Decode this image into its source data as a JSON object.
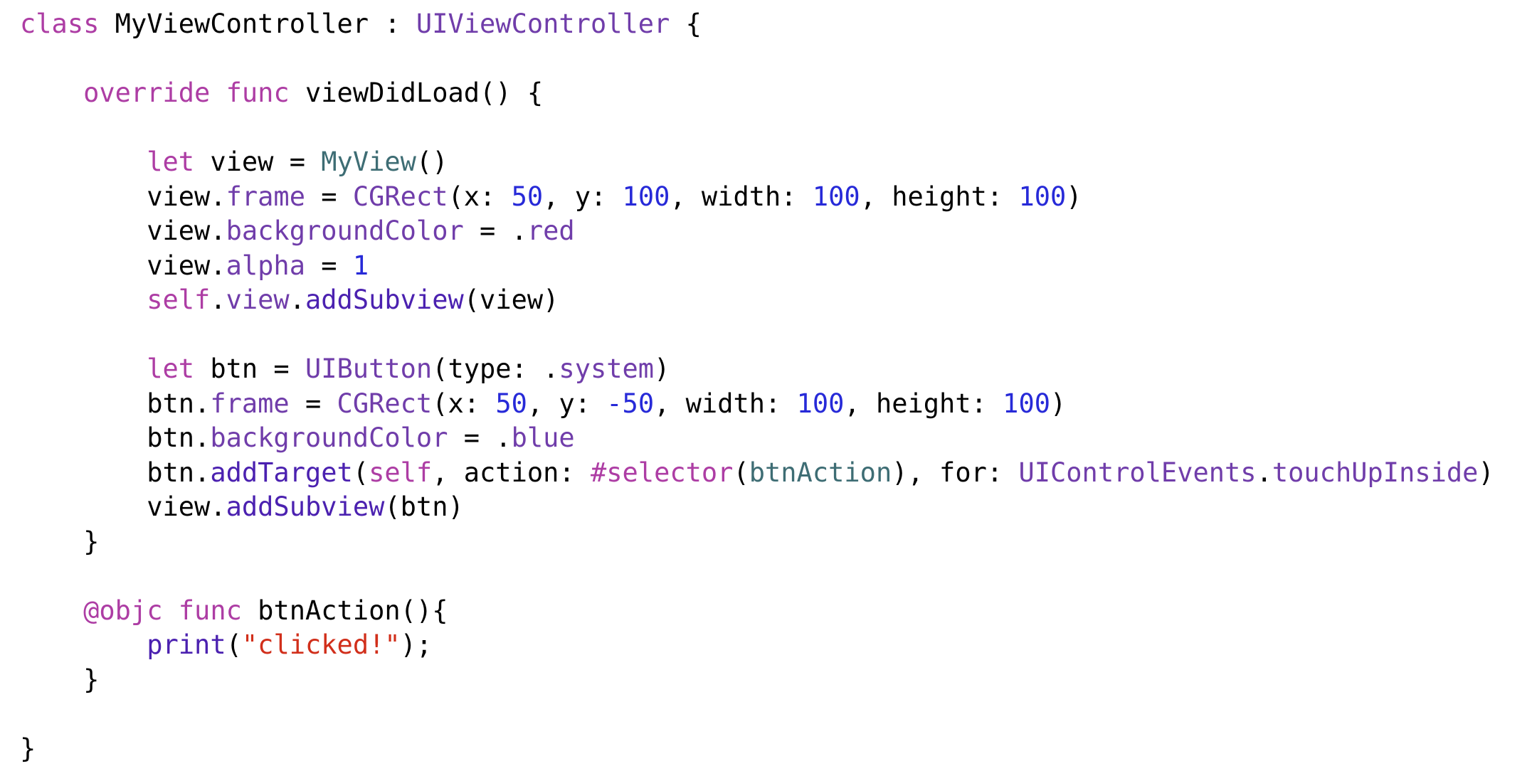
{
  "colors": {
    "plain": "#000000",
    "keyword": "#ad3da4",
    "type": "#703daa",
    "project_type": "#3e6d74",
    "project_name": "#4b21b0",
    "number": "#272ad8",
    "string": "#d12f1b"
  },
  "code": {
    "language": "Swift",
    "lines": [
      {
        "indent": "",
        "tokens": [
          [
            "keyword",
            "class"
          ],
          [
            "plain",
            " MyViewController : "
          ],
          [
            "type",
            "UIViewController"
          ],
          [
            "plain",
            " {"
          ]
        ]
      },
      {
        "indent": "",
        "tokens": []
      },
      {
        "indent": "    ",
        "tokens": [
          [
            "keyword",
            "override"
          ],
          [
            "plain",
            " "
          ],
          [
            "keyword",
            "func"
          ],
          [
            "plain",
            " viewDidLoad() {"
          ]
        ]
      },
      {
        "indent": "",
        "tokens": []
      },
      {
        "indent": "        ",
        "tokens": [
          [
            "keyword",
            "let"
          ],
          [
            "plain",
            " view = "
          ],
          [
            "project_type",
            "MyView"
          ],
          [
            "plain",
            "()"
          ]
        ]
      },
      {
        "indent": "        ",
        "tokens": [
          [
            "plain",
            "view."
          ],
          [
            "type",
            "frame"
          ],
          [
            "plain",
            " = "
          ],
          [
            "type",
            "CGRect"
          ],
          [
            "plain",
            "(x: "
          ],
          [
            "number",
            "50"
          ],
          [
            "plain",
            ", y: "
          ],
          [
            "number",
            "100"
          ],
          [
            "plain",
            ", width: "
          ],
          [
            "number",
            "100"
          ],
          [
            "plain",
            ", height: "
          ],
          [
            "number",
            "100"
          ],
          [
            "plain",
            ")"
          ]
        ]
      },
      {
        "indent": "        ",
        "tokens": [
          [
            "plain",
            "view."
          ],
          [
            "type",
            "backgroundColor"
          ],
          [
            "plain",
            " = ."
          ],
          [
            "type",
            "red"
          ]
        ]
      },
      {
        "indent": "        ",
        "tokens": [
          [
            "plain",
            "view."
          ],
          [
            "type",
            "alpha"
          ],
          [
            "plain",
            " = "
          ],
          [
            "number",
            "1"
          ]
        ]
      },
      {
        "indent": "        ",
        "tokens": [
          [
            "keyword",
            "self"
          ],
          [
            "plain",
            "."
          ],
          [
            "type",
            "view"
          ],
          [
            "plain",
            "."
          ],
          [
            "project_name",
            "addSubview"
          ],
          [
            "plain",
            "(view)"
          ]
        ]
      },
      {
        "indent": "",
        "tokens": []
      },
      {
        "indent": "        ",
        "tokens": [
          [
            "keyword",
            "let"
          ],
          [
            "plain",
            " btn = "
          ],
          [
            "type",
            "UIButton"
          ],
          [
            "plain",
            "(type: ."
          ],
          [
            "type",
            "system"
          ],
          [
            "plain",
            ")"
          ]
        ]
      },
      {
        "indent": "        ",
        "tokens": [
          [
            "plain",
            "btn."
          ],
          [
            "type",
            "frame"
          ],
          [
            "plain",
            " = "
          ],
          [
            "type",
            "CGRect"
          ],
          [
            "plain",
            "(x: "
          ],
          [
            "number",
            "50"
          ],
          [
            "plain",
            ", y: "
          ],
          [
            "number",
            "-50"
          ],
          [
            "plain",
            ", width: "
          ],
          [
            "number",
            "100"
          ],
          [
            "plain",
            ", height: "
          ],
          [
            "number",
            "100"
          ],
          [
            "plain",
            ")"
          ]
        ]
      },
      {
        "indent": "        ",
        "tokens": [
          [
            "plain",
            "btn."
          ],
          [
            "type",
            "backgroundColor"
          ],
          [
            "plain",
            " = ."
          ],
          [
            "type",
            "blue"
          ]
        ]
      },
      {
        "indent": "        ",
        "tokens": [
          [
            "plain",
            "btn."
          ],
          [
            "project_name",
            "addTarget"
          ],
          [
            "plain",
            "("
          ],
          [
            "keyword",
            "self"
          ],
          [
            "plain",
            ", action: "
          ],
          [
            "keyword",
            "#selector"
          ],
          [
            "plain",
            "("
          ],
          [
            "project_type",
            "btnAction"
          ],
          [
            "plain",
            "), for: "
          ],
          [
            "type",
            "UIControlEvents"
          ],
          [
            "plain",
            "."
          ],
          [
            "type",
            "touchUpInside"
          ],
          [
            "plain",
            ")"
          ]
        ]
      },
      {
        "indent": "        ",
        "tokens": [
          [
            "plain",
            "view."
          ],
          [
            "project_name",
            "addSubview"
          ],
          [
            "plain",
            "(btn)"
          ]
        ]
      },
      {
        "indent": "    ",
        "tokens": [
          [
            "plain",
            "}"
          ]
        ]
      },
      {
        "indent": "",
        "tokens": []
      },
      {
        "indent": "    ",
        "tokens": [
          [
            "keyword",
            "@objc"
          ],
          [
            "plain",
            " "
          ],
          [
            "keyword",
            "func"
          ],
          [
            "plain",
            " btnAction(){"
          ]
        ]
      },
      {
        "indent": "        ",
        "tokens": [
          [
            "project_name",
            "print"
          ],
          [
            "plain",
            "("
          ],
          [
            "string",
            "\"clicked!\""
          ],
          [
            "plain",
            ");"
          ]
        ]
      },
      {
        "indent": "    ",
        "tokens": [
          [
            "plain",
            "}"
          ]
        ]
      },
      {
        "indent": "",
        "tokens": []
      },
      {
        "indent": "",
        "tokens": [
          [
            "plain",
            "}"
          ]
        ]
      }
    ]
  }
}
